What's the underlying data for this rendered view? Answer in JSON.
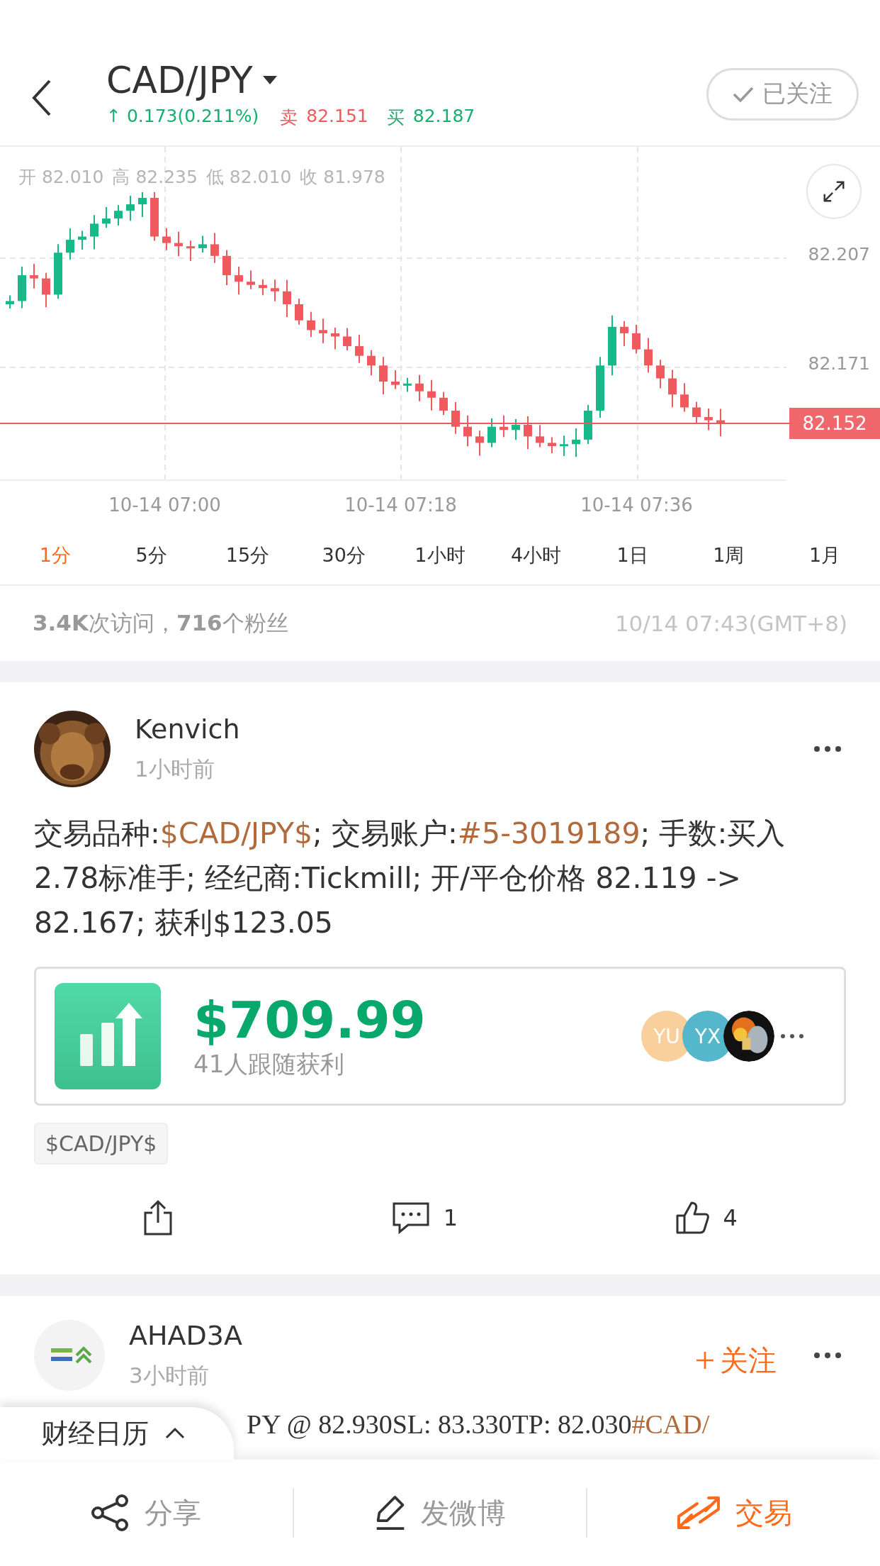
{
  "header": {
    "title": "CAD/JPY",
    "change": "↑ 0.173(0.211%)",
    "sell_label": "卖",
    "sell": "82.151",
    "buy_label": "买",
    "buy": "82.187",
    "follow": {
      "label": "已关注",
      "followed": true
    }
  },
  "chart": {
    "ohlc": [
      {
        "label": "开",
        "value": "82.010"
      },
      {
        "label": "高",
        "value": "82.235"
      },
      {
        "label": "低",
        "value": "82.010"
      },
      {
        "label": "收",
        "value": "81.978"
      }
    ],
    "y_labels": [
      "82.207",
      "82.171"
    ],
    "current_price": "82.152",
    "x_labels": [
      "10-14 07:00",
      "10-14 07:18",
      "10-14 07:36"
    ]
  },
  "intervals": [
    {
      "label": "1分",
      "selected": true
    },
    {
      "label": "5分",
      "selected": false
    },
    {
      "label": "15分",
      "selected": false
    },
    {
      "label": "30分",
      "selected": false
    },
    {
      "label": "1小时",
      "selected": false
    },
    {
      "label": "4小时",
      "selected": false
    },
    {
      "label": "1日",
      "selected": false
    },
    {
      "label": "1周",
      "selected": false
    },
    {
      "label": "1月",
      "selected": false
    }
  ],
  "stats": {
    "summary": "**3.4K**次访问，**716**个粉丝",
    "time": "10/14 07:43(GMT+8)"
  },
  "posts": [
    {
      "author": "Kenvich",
      "time": "1小时前",
      "avatar": {
        "kind": "picture"
      },
      "body": [
        {
          "kind": "text",
          "text": "交易品种:"
        },
        {
          "kind": "link",
          "text": "$CAD/JPY$"
        },
        {
          "kind": "text",
          "text": "; 交易账户:"
        },
        {
          "kind": "link",
          "text": "#5-3019189"
        },
        {
          "kind": "text",
          "text": "; 手数:买入2.78标准手; 经纪商:Tickmill; 开/平仓价格 82.119 -> 82.167; 获利$123.05"
        }
      ],
      "profit": {
        "amount": "$709.99",
        "caption": "41人跟随获利",
        "followers": [
          {
            "kind": "initials",
            "text": "YU",
            "color": "#f9cf9c"
          },
          {
            "kind": "initials",
            "text": "YX",
            "color": "#55b7cb"
          },
          {
            "kind": "picture"
          }
        ]
      },
      "tag": "$CAD/JPY$",
      "comments": "1",
      "likes": "4"
    },
    {
      "author": "AHAD3A",
      "time": "3小时前",
      "avatar": {
        "kind": "logo"
      },
      "follow": {
        "label": "关注",
        "followed": false
      },
      "body": [
        {
          "kind": "text",
          "text": "PY @ 82.930SL: 83.330TP: 82.030"
        },
        {
          "kind": "link",
          "text": "#CAD/"
        }
      ]
    }
  ],
  "calendar": {
    "label": "财经日历"
  },
  "bottom_bar": [
    {
      "label": "分享",
      "kind": "share",
      "selected": false
    },
    {
      "label": "发微博",
      "kind": "compose",
      "selected": false
    },
    {
      "label": "交易",
      "kind": "trade",
      "selected": true
    }
  ]
}
